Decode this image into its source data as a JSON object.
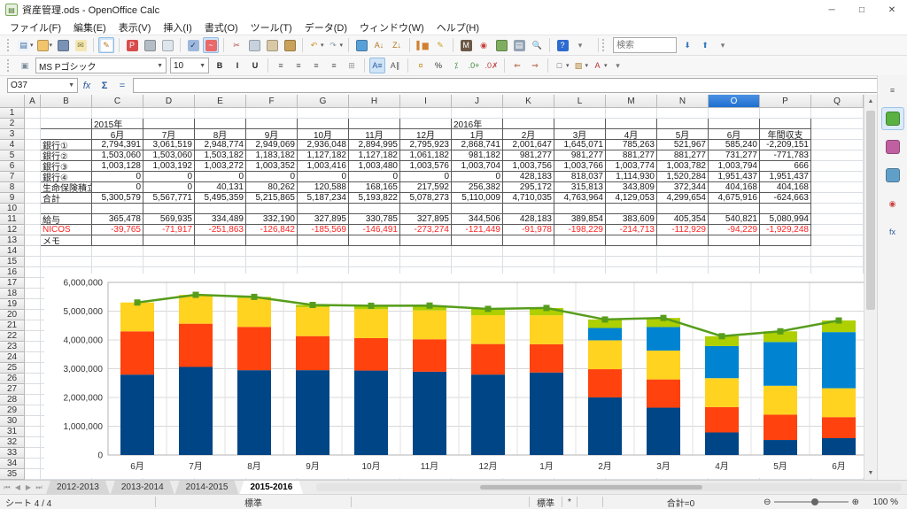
{
  "window": {
    "title": "資産管理.ods - OpenOffice Calc",
    "minimize": "─",
    "maximize": "□",
    "close": "✕"
  },
  "menubar": {
    "items": [
      "ファイル(F)",
      "編集(E)",
      "表示(V)",
      "挿入(I)",
      "書式(O)",
      "ツール(T)",
      "データ(D)",
      "ウィンドウ(W)",
      "ヘルプ(H)"
    ]
  },
  "standard_toolbar": {
    "icons": [
      {
        "n": "new-document-icon",
        "g": "▤",
        "c": "#eef3f8",
        "fg": "#3a6ea5",
        "dd": true
      },
      {
        "n": "open-folder-icon",
        "g": "",
        "c": "#f2c46c",
        "dd": true
      },
      {
        "n": "save-icon",
        "g": "",
        "c": "#7a92b5"
      },
      {
        "n": "email-icon",
        "g": "✉",
        "c": "#f3e7b4",
        "fg": "#8a7a3a"
      },
      {
        "sep": true
      },
      {
        "n": "edit-file-icon",
        "g": "✎",
        "c": "#fdfdfd",
        "fg": "#c07820",
        "active": true
      },
      {
        "sep": true
      },
      {
        "n": "export-pdf-icon",
        "g": "P",
        "c": "#d94c4c",
        "fg": "#ffffff"
      },
      {
        "n": "print-icon",
        "g": "",
        "c": "#b4bcc4"
      },
      {
        "n": "page-preview-icon",
        "g": "",
        "c": "#dde5ed"
      },
      {
        "sep": true
      },
      {
        "n": "spelling-icon",
        "g": "✓",
        "c": "#9db8dc",
        "fg": "#1a3a6a"
      },
      {
        "n": "auto-spellcheck-icon",
        "g": "~",
        "c": "#e86a6a",
        "fg": "#ffffff",
        "active": true
      },
      {
        "sep": true
      },
      {
        "n": "cut-icon",
        "g": "✂",
        "c": "transparent",
        "fg": "#b04040"
      },
      {
        "n": "copy-icon",
        "g": "",
        "c": "#c7d2de"
      },
      {
        "n": "paste-icon",
        "g": "",
        "c": "#d8c8a6"
      },
      {
        "n": "format-paintbrush-icon",
        "g": "",
        "c": "#c9a159"
      },
      {
        "sep": true
      },
      {
        "n": "undo-icon",
        "g": "↶",
        "c": "transparent",
        "fg": "#d09020",
        "dd": true
      },
      {
        "n": "redo-icon",
        "g": "↷",
        "c": "transparent",
        "fg": "#8a9aa8",
        "dd": true
      },
      {
        "sep": true
      },
      {
        "n": "hyperlink-icon",
        "g": "",
        "c": "#58a0d8"
      },
      {
        "n": "sort-ascending-icon",
        "g": "A↓",
        "c": "transparent",
        "fg": "#b07820"
      },
      {
        "n": "sort-descending-icon",
        "g": "Z↓",
        "c": "transparent",
        "fg": "#b07820"
      },
      {
        "sep": true
      },
      {
        "n": "insert-chart-icon",
        "g": "▌▆",
        "c": "transparent",
        "fg": "#d08030"
      },
      {
        "n": "draw-functions-icon",
        "g": "✎",
        "c": "transparent",
        "fg": "#c8a020"
      },
      {
        "sep": true
      },
      {
        "n": "find-replace-icon",
        "g": "M",
        "c": "#6b5846",
        "fg": "#ffffff"
      },
      {
        "n": "navigator-icon",
        "g": "◉",
        "c": "transparent",
        "fg": "#c84040"
      },
      {
        "n": "gallery-icon",
        "g": "",
        "c": "#7fae60"
      },
      {
        "n": "data-sources-icon",
        "g": "▤",
        "c": "#93a3b3",
        "fg": "#ffffff"
      },
      {
        "n": "zoom-icon",
        "g": "🔍",
        "c": "transparent",
        "fg": "#5a7a9a"
      },
      {
        "sep": true
      },
      {
        "n": "help-icon",
        "g": "?",
        "c": "#2e6bd0",
        "fg": "#ffffff"
      },
      {
        "n": "toolbar-options-icon",
        "g": "▾",
        "c": "transparent",
        "fg": "#777"
      }
    ]
  },
  "find_bar": {
    "placeholder": "検索",
    "buttons": [
      {
        "n": "find-down-icon",
        "g": "⬇",
        "c": "transparent",
        "fg": "#3a7ac0"
      },
      {
        "n": "find-up-icon",
        "g": "⬆",
        "c": "transparent",
        "fg": "#3a7ac0"
      },
      {
        "n": "findbar-options-icon",
        "g": "▾",
        "c": "transparent",
        "fg": "#777"
      }
    ]
  },
  "formatting_toolbar": {
    "styles_icon": {
      "n": "styles-window-icon",
      "g": "▣",
      "c": "transparent",
      "fg": "#7a8a9a"
    },
    "font_name": "MS Pゴシック",
    "font_size": "10",
    "icons": [
      {
        "n": "bold-icon",
        "g": "B",
        "c": "transparent",
        "fg": "#222",
        "cls": "fmt-letter"
      },
      {
        "n": "italic-icon",
        "g": "I",
        "c": "transparent",
        "fg": "#222",
        "cls": "fmt-letter"
      },
      {
        "n": "underline-icon",
        "g": "U",
        "c": "transparent",
        "fg": "#222",
        "cls": "fmt-letter"
      },
      {
        "sep": true
      },
      {
        "n": "align-left-icon",
        "g": "≡",
        "c": "transparent",
        "fg": "#555"
      },
      {
        "n": "align-center-icon",
        "g": "≡",
        "c": "transparent",
        "fg": "#555"
      },
      {
        "n": "align-right-icon",
        "g": "≡",
        "c": "transparent",
        "fg": "#555"
      },
      {
        "n": "align-justified-icon",
        "g": "≡",
        "c": "transparent",
        "fg": "#555"
      },
      {
        "n": "merge-cells-icon",
        "g": "⊞",
        "c": "transparent",
        "fg": "#999"
      },
      {
        "sep": true
      },
      {
        "n": "text-direction-ltr-icon",
        "g": "A≡",
        "c": "transparent",
        "fg": "#2a5aa0",
        "active": true
      },
      {
        "n": "text-direction-ttb-icon",
        "g": "A∥",
        "c": "transparent",
        "fg": "#555"
      },
      {
        "sep": true
      },
      {
        "n": "number-format-currency-icon",
        "g": "¤",
        "c": "transparent",
        "fg": "#c09020"
      },
      {
        "n": "number-format-percent-icon",
        "g": "%",
        "c": "transparent",
        "fg": "#333"
      },
      {
        "n": "number-format-standard-icon",
        "g": "⁒",
        "c": "transparent",
        "fg": "#3a8a3a"
      },
      {
        "n": "add-decimal-icon",
        "g": ".0+",
        "c": "transparent",
        "fg": "#3a8a3a"
      },
      {
        "n": "delete-decimal-icon",
        "g": ".0✗",
        "c": "transparent",
        "fg": "#c04040"
      },
      {
        "sep": true
      },
      {
        "n": "decrease-indent-icon",
        "g": "⇐",
        "c": "transparent",
        "fg": "#b05030"
      },
      {
        "n": "increase-indent-icon",
        "g": "⇒",
        "c": "transparent",
        "fg": "#b05030"
      },
      {
        "sep": true
      },
      {
        "n": "borders-icon",
        "g": "□",
        "c": "transparent",
        "fg": "#555",
        "dd": true
      },
      {
        "n": "background-color-icon",
        "g": "▨",
        "c": "transparent",
        "fg": "#b08030",
        "dd": true
      },
      {
        "n": "font-color-icon",
        "g": "A",
        "c": "transparent",
        "fg": "#c03030",
        "dd": true
      },
      {
        "n": "fmtbar-options-icon",
        "g": "▾",
        "c": "transparent",
        "fg": "#777"
      }
    ]
  },
  "formula_bar": {
    "cell_reference": "O37",
    "function_wizard": "fx",
    "sum_button": "Σ",
    "function_button": "=",
    "input_value": ""
  },
  "grid": {
    "columns": [
      "A",
      "B",
      "C",
      "D",
      "E",
      "F",
      "G",
      "H",
      "I",
      "J",
      "K",
      "L",
      "M",
      "N",
      "O",
      "P",
      "Q"
    ],
    "selected_column": "O",
    "visible_rows": 35
  },
  "table": {
    "year_labels": [
      {
        "row": 2,
        "col": "C",
        "text": "2015年"
      },
      {
        "row": 2,
        "col": "J",
        "text": "2016年"
      }
    ],
    "month_header": {
      "row": 3,
      "start_col": "C",
      "cells": [
        "6月",
        "7月",
        "8月",
        "9月",
        "10月",
        "11月",
        "12月",
        "1月",
        "2月",
        "3月",
        "4月",
        "5月",
        "6月",
        "年間収支"
      ]
    },
    "data_rows": [
      {
        "row": 4,
        "label": "銀行①",
        "values": [
          "2,794,391",
          "3,061,519",
          "2,948,774",
          "2,949,069",
          "2,936,048",
          "2,894,995",
          "2,795,923",
          "2,868,741",
          "2,001,647",
          "1,645,071",
          "785,263",
          "521,967",
          "585,240",
          "-2,209,151"
        ]
      },
      {
        "row": 5,
        "label": "銀行②",
        "values": [
          "1,503,060",
          "1,503,060",
          "1,503,182",
          "1,183,182",
          "1,127,182",
          "1,127,182",
          "1,061,182",
          "981,182",
          "981,277",
          "981,277",
          "881,277",
          "881,277",
          "731,277",
          "-771,783"
        ]
      },
      {
        "row": 6,
        "label": "銀行③",
        "values": [
          "1,003,128",
          "1,003,192",
          "1,003,272",
          "1,003,352",
          "1,003,416",
          "1,003,480",
          "1,003,576",
          "1,003,704",
          "1,003,756",
          "1,003,766",
          "1,003,774",
          "1,003,782",
          "1,003,794",
          "666"
        ]
      },
      {
        "row": 7,
        "label": "銀行④",
        "values": [
          "0",
          "0",
          "0",
          "0",
          "0",
          "0",
          "0",
          "0",
          "428,183",
          "818,037",
          "1,114,930",
          "1,520,284",
          "1,951,437",
          "1,951,437"
        ]
      },
      {
        "row": 8,
        "label": "生命保険積立",
        "values": [
          "0",
          "0",
          "40,131",
          "80,262",
          "120,588",
          "168,165",
          "217,592",
          "256,382",
          "295,172",
          "315,813",
          "343,809",
          "372,344",
          "404,168",
          "404,168"
        ]
      },
      {
        "row": 9,
        "label": "合計",
        "values": [
          "5,300,579",
          "5,567,771",
          "5,495,359",
          "5,215,865",
          "5,187,234",
          "5,193,822",
          "5,078,273",
          "5,110,009",
          "4,710,035",
          "4,763,964",
          "4,129,053",
          "4,299,654",
          "4,675,916",
          "-624,663"
        ]
      },
      {
        "row": 11,
        "label": "給与",
        "values": [
          "365,478",
          "569,935",
          "334,489",
          "332,190",
          "327,895",
          "330,785",
          "327,895",
          "344,506",
          "428,183",
          "389,854",
          "383,609",
          "405,354",
          "540,821",
          "5,080,994"
        ]
      },
      {
        "row": 12,
        "label": "NICOS",
        "color": "#ff2222",
        "values": [
          "-39,765",
          "-71,917",
          "-251,863",
          "-126,842",
          "-185,569",
          "-146,491",
          "-273,274",
          "-121,449",
          "-91,978",
          "-198,229",
          "-214,713",
          "-112,929",
          "-94,229",
          "-1,929,248"
        ]
      },
      {
        "row": 13,
        "label": "メモ",
        "values": []
      }
    ]
  },
  "chart_data": {
    "type": "bar",
    "subtype": "stacked-with-line",
    "title": "",
    "xlabel": "",
    "ylabel": "",
    "ylim": [
      0,
      6000000
    ],
    "ytick_step": 1000000,
    "grid": true,
    "legend_position": "none",
    "categories": [
      "6月",
      "7月",
      "8月",
      "9月",
      "10月",
      "11月",
      "12月",
      "1月",
      "2月",
      "3月",
      "4月",
      "5月",
      "6月"
    ],
    "series": [
      {
        "name": "銀行①",
        "color": "#004586",
        "values": [
          2794391,
          3061519,
          2948774,
          2949069,
          2936048,
          2894995,
          2795923,
          2868741,
          2001647,
          1645071,
          785263,
          521967,
          585240
        ]
      },
      {
        "name": "銀行②",
        "color": "#ff420e",
        "values": [
          1503060,
          1503060,
          1503182,
          1183182,
          1127182,
          1127182,
          1061182,
          981182,
          981277,
          981277,
          881277,
          881277,
          731277
        ]
      },
      {
        "name": "銀行③",
        "color": "#ffd320",
        "values": [
          1003128,
          1003192,
          1003272,
          1003352,
          1003416,
          1003480,
          1003576,
          1003704,
          1003756,
          1003766,
          1003774,
          1003782,
          1003794
        ]
      },
      {
        "name": "銀行④",
        "color": "#0084d1",
        "values": [
          0,
          0,
          0,
          0,
          0,
          0,
          0,
          0,
          428183,
          818037,
          1114930,
          1520284,
          1951437
        ]
      },
      {
        "name": "生命保険積立",
        "color": "#aecf00",
        "values": [
          0,
          0,
          40131,
          80262,
          120588,
          168165,
          217592,
          256382,
          295172,
          315813,
          343809,
          372344,
          404168
        ]
      }
    ],
    "line_series": {
      "name": "合計",
      "color": "#579d1c",
      "values": [
        5300579,
        5567771,
        5495359,
        5215865,
        5187234,
        5193822,
        5078273,
        5110009,
        4710035,
        4763964,
        4129053,
        4299654,
        4675916
      ]
    }
  },
  "sheet_tabs": {
    "nav": [
      "⏮",
      "◀",
      "▶",
      "⏭"
    ],
    "tabs": [
      "2012-2013",
      "2013-2014",
      "2014-2015",
      "2015-2016"
    ],
    "active_tab": "2015-2016"
  },
  "status_bar": {
    "sheet_indicator": "シート 4 / 4",
    "page_style": "標準",
    "selection_mode": "標準",
    "modified_flag": "*",
    "sum_display": "合計=0",
    "zoom_out": "⊖",
    "zoom_in": "⊕",
    "zoom_level": "100 %"
  },
  "sidebar": {
    "tabs": [
      {
        "n": "sidebar-menu-icon",
        "g": "≡",
        "c": "transparent",
        "fg": "#555"
      },
      {
        "n": "properties-icon",
        "g": "",
        "c": "#5ab040",
        "active": true
      },
      {
        "n": "styles-icon",
        "g": "",
        "c": "#c060a0"
      },
      {
        "n": "gallery-icon",
        "g": "",
        "c": "#60a0c8"
      },
      {
        "n": "navigator-icon",
        "g": "◉",
        "c": "transparent",
        "fg": "#c84040"
      },
      {
        "n": "functions-icon",
        "g": "fx",
        "c": "transparent",
        "fg": "#2a5aa0"
      }
    ]
  }
}
